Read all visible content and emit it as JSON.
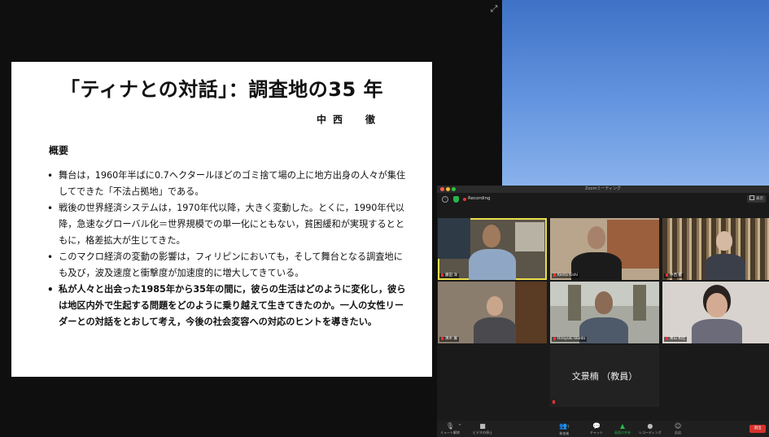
{
  "slide": {
    "title": "「ティナとの対話」：調査地の35 年",
    "author": "中西　徹",
    "subtitle": "概要",
    "bullets": [
      {
        "text": "舞台は，1960年半ばに0.7ヘクタールほどのゴミ捨て場の上に地方出身の人々が集住してできた「不法占拠地」である。",
        "bold": false
      },
      {
        "text": "戦後の世界経済システムは，1970年代以降，大きく変動した。とくに，1990年代以降，急速なグローバル化＝世界規模での単一化にともない，貧困緩和が実現するとともに，格差拡大が生じてきた。",
        "bold": false
      },
      {
        "text": "このマクロ経済の変動の影響は，フィリピンにおいても，そして舞台となる調査地にも及び，波及速度と衝撃度が加速度的に増大してきている。",
        "bold": false
      },
      {
        "text": "私が人々と出会った1985年から35年の間に，彼らの生活はどのように変化し，彼らは地区内外で生起する問題をどのように乗り越えて生きてきたのか。一人の女性リーダーとの対話をとおして考え，今後の社会変容への対応のヒントを導きたい。",
        "bold": true
      }
    ]
  },
  "zoom": {
    "window_title": "Zoomミーティング",
    "recording_label": "Recording",
    "view_label": "表示",
    "participants": [
      {
        "name": "藤田 洋",
        "active": true
      },
      {
        "name": "Kenta Kishi",
        "active": false
      },
      {
        "name": "中西 徹",
        "active": false
      },
      {
        "name": "清水 展",
        "active": false
      },
      {
        "name": "Hiroyuki Ukeda",
        "active": false
      },
      {
        "name": "青山 和佳",
        "active": false
      }
    ],
    "name_only_tile": "文景楠 （教員）",
    "toolbar": {
      "mute": "ミュート解除",
      "video": "ビデオの停止",
      "participants": "参加者",
      "participants_count": "7",
      "chat": "チャット",
      "share": "画面の共有",
      "record": "レコーディング",
      "reactions": "反応",
      "end": "退出"
    }
  },
  "colors": {
    "active_speaker": "#e9df4a",
    "end_button": "#d6322d",
    "share_green": "#2ab34a",
    "wallpaper": "#4f82d2"
  }
}
